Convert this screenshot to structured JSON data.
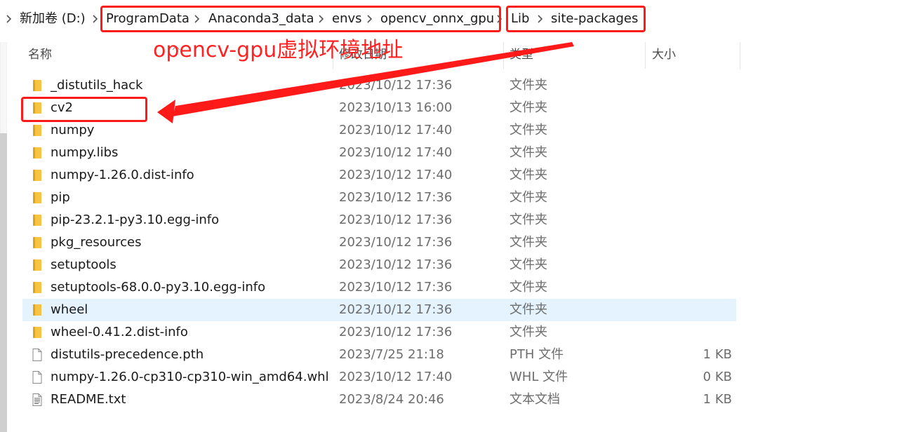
{
  "breadcrumb": {
    "items": [
      "新加卷 (D:)",
      "ProgramData",
      "Anaconda3_data",
      "envs",
      "opencv_onnx_gpu",
      "Lib",
      "site-packages"
    ]
  },
  "columns": {
    "name": "名称",
    "modified": "修改日期",
    "type": "类型",
    "size": "大小"
  },
  "annotation": {
    "text": "opencv-gpu虚拟环境地址",
    "color": "#ff2222"
  },
  "files": [
    {
      "name": "_distutils_hack",
      "modified": "2023/10/12 17:36",
      "type": "文件夹",
      "size": "",
      "icon": "folder-icon"
    },
    {
      "name": "cv2",
      "modified": "2023/10/13 16:00",
      "type": "文件夹",
      "size": "",
      "icon": "folder-icon"
    },
    {
      "name": "numpy",
      "modified": "2023/10/12 17:40",
      "type": "文件夹",
      "size": "",
      "icon": "folder-icon"
    },
    {
      "name": "numpy.libs",
      "modified": "2023/10/12 17:40",
      "type": "文件夹",
      "size": "",
      "icon": "folder-icon"
    },
    {
      "name": "numpy-1.26.0.dist-info",
      "modified": "2023/10/12 17:40",
      "type": "文件夹",
      "size": "",
      "icon": "folder-icon"
    },
    {
      "name": "pip",
      "modified": "2023/10/12 17:36",
      "type": "文件夹",
      "size": "",
      "icon": "folder-icon"
    },
    {
      "name": "pip-23.2.1-py3.10.egg-info",
      "modified": "2023/10/12 17:36",
      "type": "文件夹",
      "size": "",
      "icon": "folder-icon"
    },
    {
      "name": "pkg_resources",
      "modified": "2023/10/12 17:36",
      "type": "文件夹",
      "size": "",
      "icon": "folder-icon"
    },
    {
      "name": "setuptools",
      "modified": "2023/10/12 17:36",
      "type": "文件夹",
      "size": "",
      "icon": "folder-icon"
    },
    {
      "name": "setuptools-68.0.0-py3.10.egg-info",
      "modified": "2023/10/12 17:36",
      "type": "文件夹",
      "size": "",
      "icon": "folder-icon"
    },
    {
      "name": "wheel",
      "modified": "2023/10/12 17:36",
      "type": "文件夹",
      "size": "",
      "icon": "folder-icon"
    },
    {
      "name": "wheel-0.41.2.dist-info",
      "modified": "2023/10/12 17:36",
      "type": "文件夹",
      "size": "",
      "icon": "folder-icon"
    },
    {
      "name": "distutils-precedence.pth",
      "modified": "2023/7/25 21:18",
      "type": "PTH 文件",
      "size": "1 KB",
      "icon": "file-icon"
    },
    {
      "name": "numpy-1.26.0-cp310-cp310-win_amd64.whl",
      "modified": "2023/10/12 17:40",
      "type": "WHL 文件",
      "size": "0 KB",
      "icon": "file-icon"
    },
    {
      "name": "README.txt",
      "modified": "2023/8/24 20:46",
      "type": "文本文档",
      "size": "1 KB",
      "icon": "text-file-icon"
    }
  ],
  "colors": {
    "highlight": "#ff1a1a",
    "selected_row": "#e5f3ff",
    "folder": "#f6c344"
  }
}
